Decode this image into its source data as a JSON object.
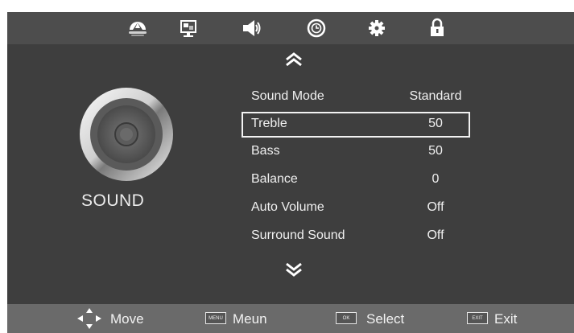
{
  "top_nav": {
    "items": [
      {
        "name": "picture-icon"
      },
      {
        "name": "screen-icon"
      },
      {
        "name": "sound-icon"
      },
      {
        "name": "clock-icon"
      },
      {
        "name": "settings-icon"
      },
      {
        "name": "lock-icon"
      }
    ],
    "active": "sound-icon"
  },
  "section": {
    "title": "SOUND"
  },
  "menu": {
    "items": [
      {
        "label": "Sound Mode",
        "value": "Standard"
      },
      {
        "label": "Treble",
        "value": "50"
      },
      {
        "label": "Bass",
        "value": "50"
      },
      {
        "label": "Balance",
        "value": "0"
      },
      {
        "label": "Auto Volume",
        "value": "Off"
      },
      {
        "label": "Surround Sound",
        "value": "Off"
      }
    ],
    "selected_index": 1
  },
  "footer": {
    "move": {
      "label": "Move"
    },
    "menu": {
      "key": "MENU",
      "label": "Meun"
    },
    "select": {
      "key": "OK",
      "label": "Select"
    },
    "exit": {
      "key": "EXIT",
      "label": "Exit"
    }
  },
  "colors": {
    "background": "#3e3e3e",
    "top_bar": "#4d4d4d",
    "bottom_bar": "#6a6a6a",
    "text": "#f0f0f0"
  }
}
